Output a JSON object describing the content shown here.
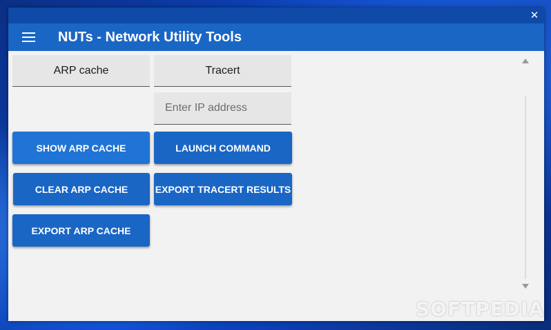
{
  "window": {
    "close_glyph": "✕"
  },
  "appbar": {
    "title": "NUTs - Network Utility Tools",
    "menu_icon": "hamburger-menu-icon"
  },
  "tabs": {
    "arp_cache": "ARP cache",
    "tracert": "Tracert"
  },
  "tracert": {
    "ip_placeholder": "Enter IP address",
    "launch_label": "LAUNCH COMMAND",
    "export_label": "EXPORT TRACERT RESULTS"
  },
  "arp": {
    "show_label": "SHOW ARP CACHE",
    "clear_label": "CLEAR ARP CACHE",
    "export_label": "EXPORT ARP CACHE"
  },
  "watermark": "SOFTPEDIA",
  "colors": {
    "primary": "#1a66c5",
    "titlebar": "#0f4aa8",
    "background": "#f2f2f2"
  }
}
